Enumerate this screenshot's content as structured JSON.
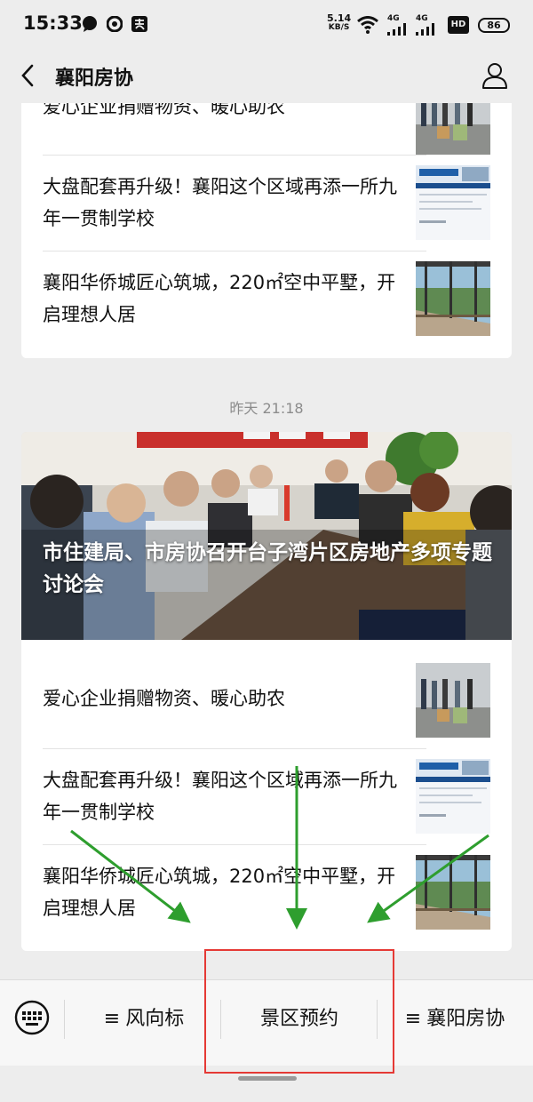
{
  "status_bar": {
    "time": "15:33",
    "net_speed_value": "5.14",
    "net_speed_unit": "KB/S",
    "signal1_label": "4G",
    "signal2_label": "4G",
    "hd_label": "HD",
    "battery": "86",
    "icons": [
      "chat-bubble-icon",
      "target-icon",
      "alipay-icon",
      "wifi-icon",
      "signal-icon",
      "signal-icon",
      "hd-icon",
      "battery-icon"
    ]
  },
  "header": {
    "title": "襄阳房协",
    "back_icon": "chevron-left-icon",
    "profile_icon": "user-icon"
  },
  "feed": {
    "top_card": {
      "items": [
        {
          "title": "爱心企业捐赠物资、暖心助农"
        },
        {
          "title": "大盘配套再升级！襄阳这个区域再添一所九年一贯制学校"
        },
        {
          "title": "襄阳华侨城匠心筑城，220㎡空中平墅，开启理想人居"
        }
      ]
    },
    "timestamp": "昨天 21:18",
    "card": {
      "hero_title": "市住建局、市房协召开台子湾片区房地产多项专题讨论会",
      "items": [
        {
          "title": "爱心企业捐赠物资、暖心助农"
        },
        {
          "title": "大盘配套再升级！襄阳这个区域再添一所九年一贯制学校"
        },
        {
          "title": "襄阳华侨城匠心筑城，220㎡空中平墅，开启理想人居"
        }
      ]
    }
  },
  "menu": {
    "keyboard_icon": "keyboard-icon",
    "items": [
      {
        "prefix": "≡",
        "label": "风向标"
      },
      {
        "prefix": "",
        "label": "景区预约"
      },
      {
        "prefix": "≡",
        "label": "襄阳房协"
      }
    ]
  },
  "colors": {
    "background": "#ededed",
    "highlight_box": "#e53935",
    "annotation_arrows": "#2e9e2e"
  }
}
